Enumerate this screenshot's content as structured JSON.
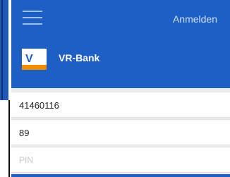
{
  "header": {
    "login_label": "Anmelden"
  },
  "bank": {
    "name": "VR-Bank",
    "logo_text": "V",
    "logo_icon": "vr-bank-logo-icon"
  },
  "fields": {
    "bank_code": "41460116",
    "account_suffix": "89",
    "pin_placeholder": "PIN"
  },
  "colors": {
    "primary_blue": "#1d5fc4",
    "logo_orange": "#f28c00",
    "background": "#ececec"
  }
}
